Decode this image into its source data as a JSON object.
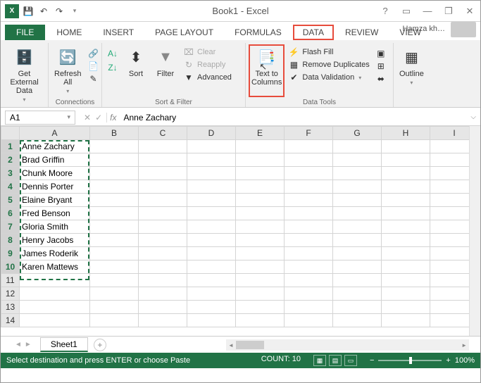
{
  "title": "Book1 - Excel",
  "account": "Hamza kh…",
  "tabs": [
    "FILE",
    "HOME",
    "INSERT",
    "PAGE LAYOUT",
    "FORMULAS",
    "DATA",
    "REVIEW",
    "VIEW"
  ],
  "active_tab": "DATA",
  "ribbon": {
    "groups": {
      "getdata": {
        "label": "",
        "btn": "Get External\nData"
      },
      "connections": {
        "label": "Connections",
        "refresh": "Refresh\nAll"
      },
      "sortfilter": {
        "label": "Sort & Filter",
        "sort": "Sort",
        "filter": "Filter",
        "clear": "Clear",
        "reapply": "Reapply",
        "advanced": "Advanced"
      },
      "datatools": {
        "label": "Data Tools",
        "ttc": "Text to\nColumns",
        "flash": "Flash Fill",
        "dup": "Remove Duplicates",
        "valid": "Data Validation"
      },
      "outline": {
        "label": "",
        "btn": "Outline"
      }
    }
  },
  "namebox": "A1",
  "formula": "Anne Zachary",
  "columns": [
    "A",
    "B",
    "C",
    "D",
    "E",
    "F",
    "G",
    "H",
    "I"
  ],
  "row_count": 14,
  "selected_rows": [
    1,
    2,
    3,
    4,
    5,
    6,
    7,
    8,
    9,
    10
  ],
  "cells": {
    "A": [
      "Anne Zachary",
      "Brad Griffin",
      "Chunk Moore",
      "Dennis Porter",
      "Elaine Bryant",
      "Fred Benson",
      "Gloria Smith",
      "Henry Jacobs",
      "James Roderik",
      "Karen Mattews"
    ]
  },
  "sheet": "Sheet1",
  "status": {
    "msg": "Select destination and press ENTER or choose Paste",
    "count": "COUNT: 10",
    "zoom": "100%"
  }
}
